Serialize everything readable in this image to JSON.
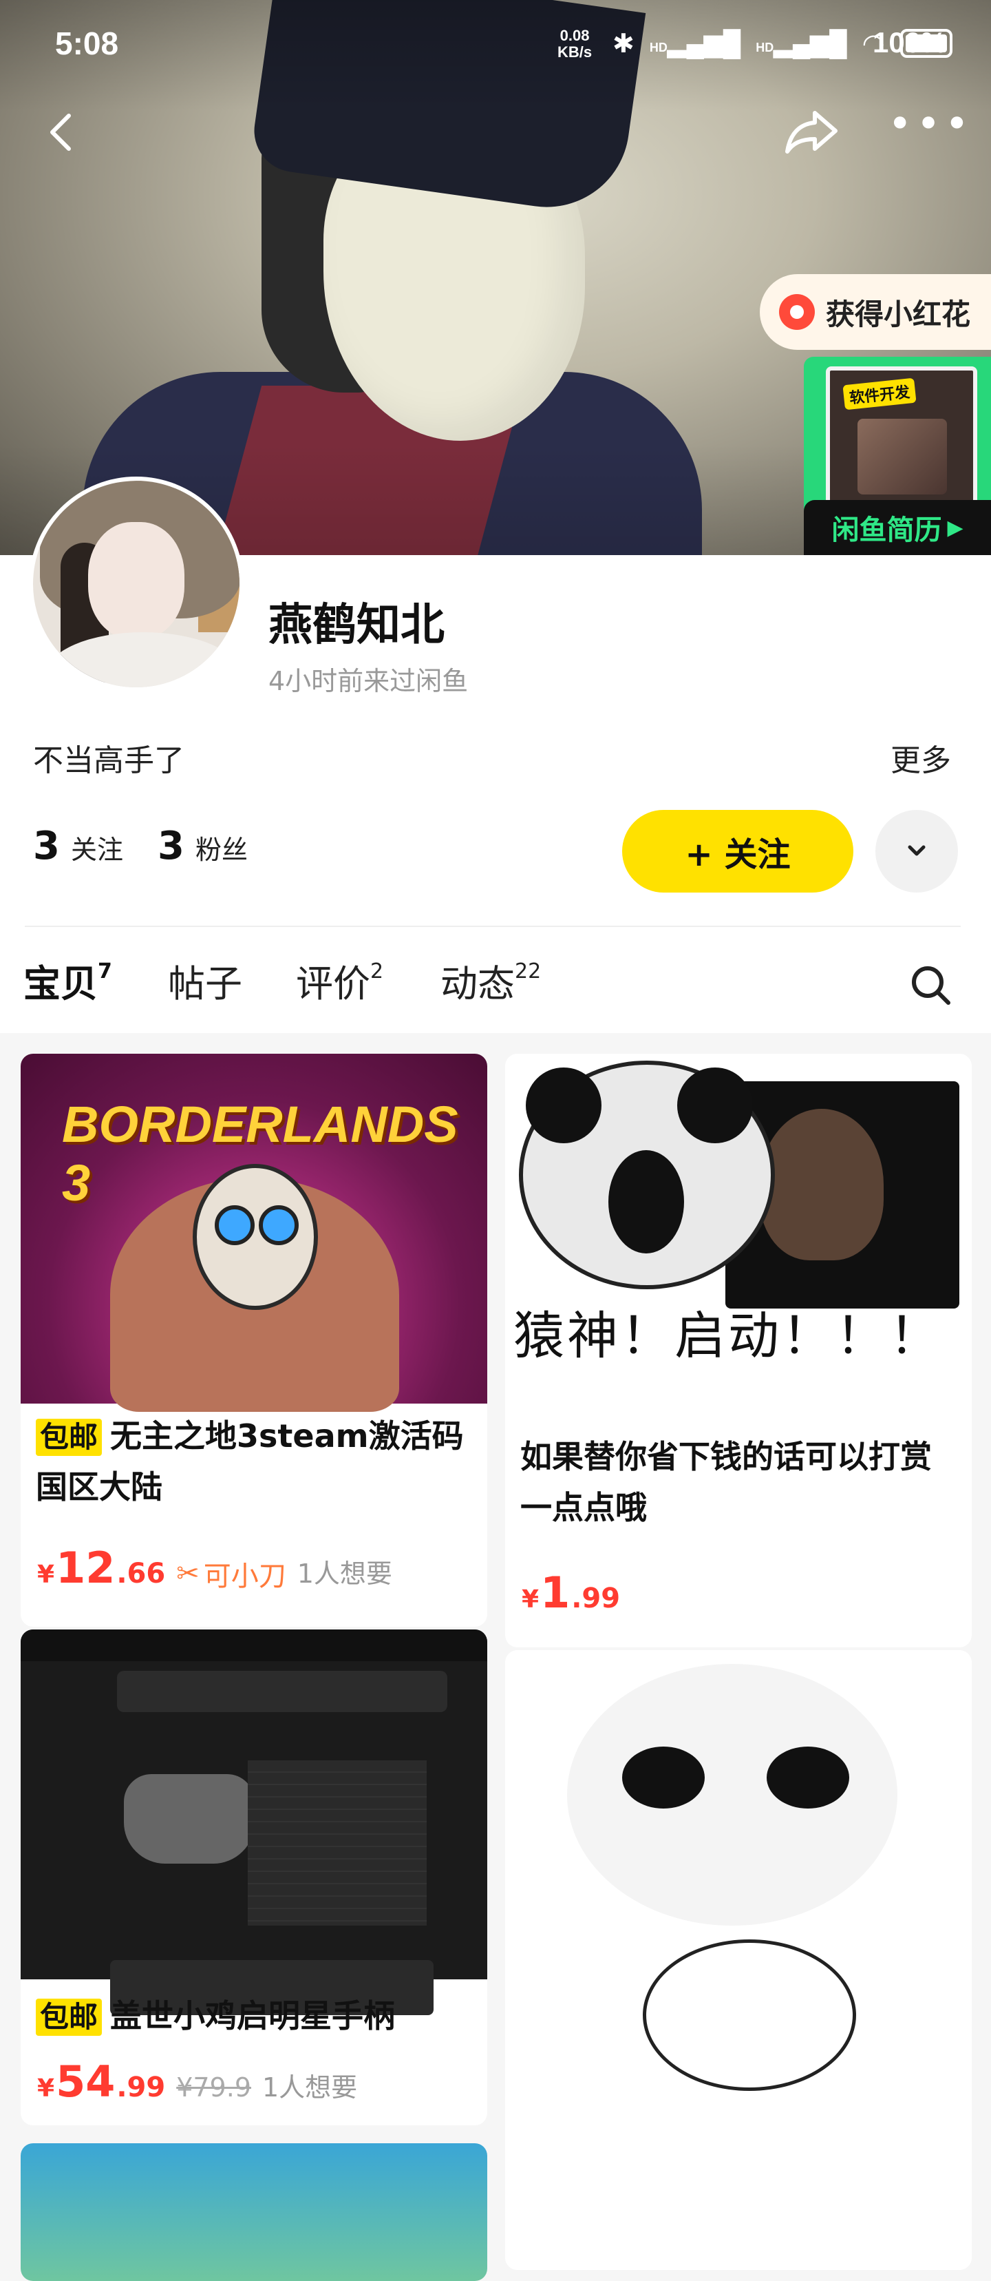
{
  "status_bar": {
    "time": "5:08",
    "net_speed": "0.08",
    "net_unit": "KB/s",
    "hd1": "HD",
    "hd2": "HD",
    "battery": "100%"
  },
  "header": {
    "flower_badge": "获得小红花",
    "resume_tag": "软件开发",
    "resume_label": "闲鱼简历"
  },
  "profile": {
    "name": "燕鹤知北",
    "last_seen": "4小时前来过闲鱼",
    "bio": "不当高手了",
    "more": "更多",
    "following_count": "3",
    "following_label": "关注",
    "fans_count": "3",
    "fans_label": "粉丝",
    "follow_button": "+ 关注"
  },
  "tabs": [
    {
      "label": "宝贝",
      "count": "7"
    },
    {
      "label": "帖子",
      "count": ""
    },
    {
      "label": "评价",
      "count": "2"
    },
    {
      "label": "动态",
      "count": "22"
    }
  ],
  "items": [
    {
      "badge": "包邮",
      "title": "无主之地3steam激活码国区大陆",
      "price_int": "12",
      "price_dec": ".66",
      "bargain": "可小刀",
      "want": "1人想要",
      "image_text": "BORDERLANDS 3"
    },
    {
      "title": "如果替你省下钱的话可以打赏一点点哦",
      "price_int": "1",
      "price_dec": ".99",
      "image_caption": "猿神！启动！！！"
    },
    {
      "badge": "包邮",
      "title": "盖世小鸡启明星手柄",
      "price_int": "54",
      "price_dec": ".99",
      "orig_price": "¥79.9",
      "want": "1人想要"
    }
  ],
  "currency": "¥",
  "colors": {
    "accent_yellow": "#ffe100",
    "price_red": "#ff3b30",
    "resume_green": "#28d77a"
  }
}
